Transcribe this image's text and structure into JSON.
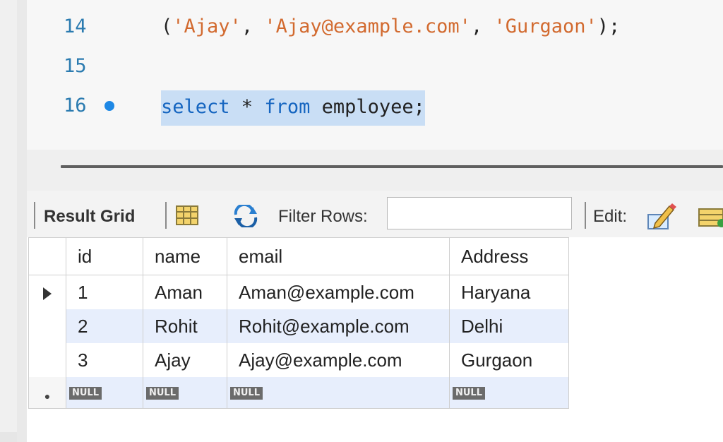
{
  "editor": {
    "lines": [
      {
        "number": "14",
        "code_parts": [
          {
            "text": "('Ajay'",
            "type": "mix"
          }
        ]
      },
      {
        "number": "15"
      },
      {
        "number": "16"
      }
    ],
    "line14": {
      "open": "(",
      "s1": "'Ajay'",
      "c1": ", ",
      "s2": "'Ajay@example.com'",
      "c2": ", ",
      "s3": "'Gurgaon'",
      "close": ");"
    },
    "line16": {
      "kw1": "select",
      "mid": " * ",
      "kw2": "from",
      "rest": " employee;"
    }
  },
  "toolbar": {
    "result_tab": "Result Grid",
    "filter_label": "Filter Rows:",
    "filter_value": "",
    "edit_label": "Edit:"
  },
  "grid": {
    "columns": [
      "id",
      "name",
      "email",
      "Address"
    ],
    "rows": [
      [
        "1",
        "Aman",
        "Aman@example.com",
        "Haryana"
      ],
      [
        "2",
        "Rohit",
        "Rohit@example.com",
        "Delhi"
      ],
      [
        "3",
        "Ajay",
        "Ajay@example.com",
        "Gurgaon"
      ]
    ],
    "null_label": "NULL"
  },
  "colors": {
    "keyword": "#1565c0",
    "string": "#d26a2f",
    "line_number": "#2b7bb0",
    "selection": "#c9def5",
    "alt_row": "#e7eefc"
  }
}
